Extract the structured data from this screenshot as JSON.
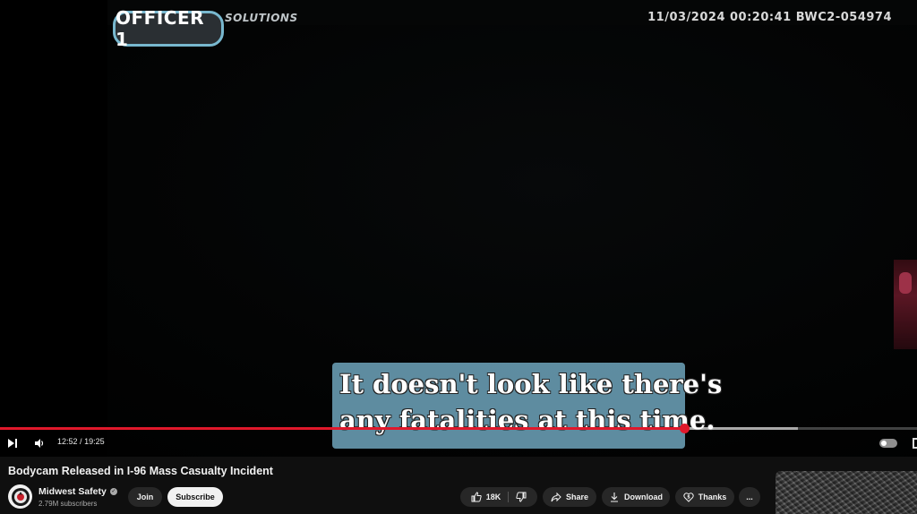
{
  "video": {
    "badge": "OFFICER 1",
    "brand_partial": "SOLUTIONS",
    "stamp": "11/03/2024 00:20:41 BWC2-054974",
    "caption_line1": "It doesn't look like there's",
    "caption_line2": "any fatalities at this time.",
    "elapsed": "12:52",
    "duration": "19:25",
    "played_fraction": 0.746,
    "buffered_fraction": 0.87
  },
  "info": {
    "title": "Bodycam Released in I-96 Mass Casualty Incident",
    "channel_name": "Midwest Safety",
    "subscribers": "2.79M subscribers",
    "join_label": "Join",
    "subscribe_label": "Subscribe",
    "like_count": "18K",
    "share_label": "Share",
    "download_label": "Download",
    "thanks_label": "Thanks",
    "more_label": "..."
  },
  "icons": {
    "next": "skip-next-icon",
    "volume": "volume-icon",
    "like": "thumbs-up-icon",
    "dislike": "thumbs-down-icon",
    "share": "share-arrow-icon",
    "download": "download-icon",
    "thanks": "super-thanks-icon",
    "more": "more-horizontal-icon"
  },
  "colors": {
    "progress": "#e0182b",
    "caption_bg": "#78b4cd",
    "badge_border": "#78b8cf"
  }
}
